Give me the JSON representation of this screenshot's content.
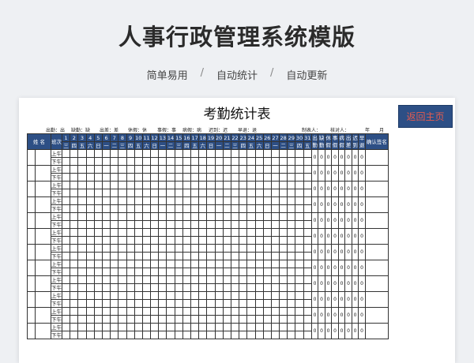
{
  "header": {
    "title": "人事行政管理系统模版",
    "tags": [
      "简单易用",
      "自动统计",
      "自动更新"
    ],
    "separator": "/"
  },
  "sheet": {
    "title": "考勤统计表",
    "back_button": "返回主页",
    "legend": [
      "出勤：出",
      "缺勤：缺",
      "出差：差",
      "休假：休",
      "事假：事",
      "病假：病",
      "迟到：迟",
      "早退：退",
      "制表人：",
      "核对人：",
      "年",
      "月"
    ],
    "columns": {
      "name": "姓 名",
      "shift": "班次",
      "days": [
        "1",
        "2",
        "3",
        "4",
        "5",
        "6",
        "7",
        "8",
        "9",
        "10",
        "11",
        "12",
        "13",
        "14",
        "15",
        "16",
        "17",
        "18",
        "19",
        "20",
        "21",
        "22",
        "23",
        "24",
        "25",
        "26",
        "27",
        "28",
        "29",
        "30",
        "31"
      ],
      "weekdays": [
        "三",
        "四",
        "五",
        "六",
        "日",
        "一",
        "二",
        "三",
        "四",
        "五",
        "六",
        "日",
        "一",
        "二",
        "三",
        "四",
        "五",
        "六",
        "日",
        "一",
        "二",
        "三",
        "四",
        "五",
        "六",
        "日",
        "一",
        "二",
        "三",
        "四",
        "五"
      ],
      "stats": [
        "出勤",
        "缺勤",
        "休假",
        "事假",
        "病假",
        "出差",
        "迟到",
        "早退"
      ],
      "confirm": "确认签名"
    },
    "shifts": [
      "上午",
      "下午"
    ],
    "employee_count": 12,
    "stat_value": "0"
  }
}
